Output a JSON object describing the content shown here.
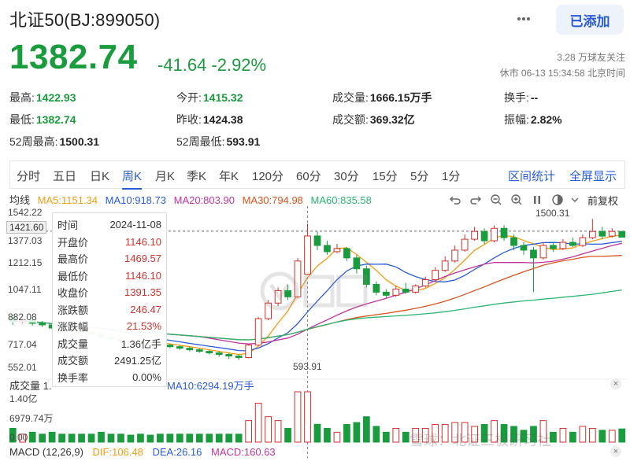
{
  "header": {
    "title": "北证50(BJ:899050)",
    "add_label": "已添加",
    "price": "1382.74",
    "change": "-41.64",
    "change_pct": "-2.92%",
    "followers": "3.28 万球友关注",
    "status": "休市 06-13 15:34:58 北京时间"
  },
  "stats": {
    "high_label": "最高:",
    "high": "1422.93",
    "open_label": "今开:",
    "open": "1415.32",
    "volume_label": "成交量:",
    "volume": "1666.15万手",
    "turnover_label": "换手:",
    "turnover": "--",
    "low_label": "最低:",
    "low": "1382.74",
    "prev_label": "昨收:",
    "prev": "1424.38",
    "amount_label": "成交额:",
    "amount": "369.32亿",
    "amplitude_label": "振幅:",
    "amplitude": "2.82%",
    "w52h_label": "52周最高:",
    "w52h": "1500.31",
    "w52l_label": "52周最低:",
    "w52l": "593.91"
  },
  "tabs": [
    "分时",
    "五日",
    "日K",
    "周K",
    "月K",
    "季K",
    "年K",
    "120分",
    "60分",
    "30分",
    "15分",
    "5分",
    "1分"
  ],
  "active_tab": "周K",
  "tabs_right": [
    "区间统计",
    "全屏显示"
  ],
  "ma": {
    "label": "均线",
    "ma5": "MA5:1151.34",
    "ma10": "MA10:918.73",
    "ma20": "MA20:803.90",
    "ma30": "MA30:794.98",
    "ma60": "MA60:835.58"
  },
  "fq_label": "前复权",
  "y_labels": [
    "1542.22",
    "1377.03",
    "1212.15",
    "1047.11",
    "882.08",
    "717.04",
    "552.01"
  ],
  "y_current": "1421.60",
  "high_marker": "1500.31",
  "low_marker": "593.91",
  "tooltip": {
    "rows": [
      {
        "k": "时间",
        "v": "2024-11-08"
      },
      {
        "k": "开盘价",
        "v": "1146.10"
      },
      {
        "k": "最高价",
        "v": "1469.57"
      },
      {
        "k": "最低价",
        "v": "1146.10"
      },
      {
        "k": "收盘价",
        "v": "1391.35"
      },
      {
        "k": "涨跌额",
        "v": "246.47"
      },
      {
        "k": "涨跌幅",
        "v": "21.53%"
      },
      {
        "k": "成交量",
        "v": "1.36亿手"
      },
      {
        "k": "成交额",
        "v": "2491.25亿"
      },
      {
        "k": "换手率",
        "v": "0.00%"
      }
    ]
  },
  "volume": {
    "label": "成交量 1.",
    "ma10": "MA10:6294.19万手",
    "y_labels": [
      "1.40亿",
      "6979.74万",
      "0.00"
    ]
  },
  "macd": {
    "label": "MACD (12,26,9)",
    "dif": "DIF:106.48",
    "dea": "DEA:26.16",
    "macd": "MACD:160.63"
  },
  "watermark": "雪球：北证三板研习社",
  "colors": {
    "up": "#d0312d",
    "down": "#1a9c3e",
    "accent": "#2a5bd7",
    "ma5": "#f39c12",
    "ma10": "#2a5bd7",
    "ma20": "#c0349b",
    "ma30": "#d9541e",
    "ma60": "#2bb673"
  },
  "chart_data": {
    "type": "candlestick",
    "y_range": [
      552.01,
      1542.22
    ],
    "weekly_candles": [
      {
        "o": 880,
        "c": 840,
        "h": 900,
        "l": 820
      },
      {
        "o": 840,
        "c": 850,
        "h": 870,
        "l": 830
      },
      {
        "o": 850,
        "c": 830,
        "h": 860,
        "l": 815
      },
      {
        "o": 830,
        "c": 820,
        "h": 845,
        "l": 805
      },
      {
        "o": 820,
        "c": 800,
        "h": 830,
        "l": 790
      },
      {
        "o": 800,
        "c": 790,
        "h": 815,
        "l": 780
      },
      {
        "o": 790,
        "c": 780,
        "h": 800,
        "l": 770
      },
      {
        "o": 780,
        "c": 770,
        "h": 790,
        "l": 760
      },
      {
        "o": 770,
        "c": 760,
        "h": 780,
        "l": 750
      },
      {
        "o": 760,
        "c": 740,
        "h": 770,
        "l": 730
      },
      {
        "o": 740,
        "c": 730,
        "h": 752,
        "l": 720
      },
      {
        "o": 730,
        "c": 720,
        "h": 740,
        "l": 710
      },
      {
        "o": 720,
        "c": 715,
        "h": 735,
        "l": 700
      },
      {
        "o": 715,
        "c": 705,
        "h": 725,
        "l": 695
      },
      {
        "o": 705,
        "c": 700,
        "h": 715,
        "l": 690
      },
      {
        "o": 700,
        "c": 690,
        "h": 710,
        "l": 680
      },
      {
        "o": 690,
        "c": 680,
        "h": 700,
        "l": 670
      },
      {
        "o": 680,
        "c": 670,
        "h": 690,
        "l": 660
      },
      {
        "o": 670,
        "c": 660,
        "h": 680,
        "l": 650
      },
      {
        "o": 660,
        "c": 650,
        "h": 670,
        "l": 640
      },
      {
        "o": 650,
        "c": 640,
        "h": 660,
        "l": 630
      },
      {
        "o": 640,
        "c": 630,
        "h": 650,
        "l": 615
      },
      {
        "o": 630,
        "c": 620,
        "h": 640,
        "l": 600
      },
      {
        "o": 620,
        "c": 610,
        "h": 630,
        "l": 594
      },
      {
        "o": 610,
        "c": 690,
        "h": 700,
        "l": 605
      },
      {
        "o": 690,
        "c": 860,
        "h": 870,
        "l": 685
      },
      {
        "o": 860,
        "c": 960,
        "h": 980,
        "l": 850
      },
      {
        "o": 960,
        "c": 1040,
        "h": 1060,
        "l": 940
      },
      {
        "o": 1040,
        "c": 1000,
        "h": 1080,
        "l": 980
      },
      {
        "o": 1000,
        "c": 1230,
        "h": 1250,
        "l": 990
      },
      {
        "o": 1146,
        "c": 1391,
        "h": 1470,
        "l": 1146
      },
      {
        "o": 1391,
        "c": 1330,
        "h": 1420,
        "l": 1300
      },
      {
        "o": 1330,
        "c": 1290,
        "h": 1360,
        "l": 1270
      },
      {
        "o": 1290,
        "c": 1310,
        "h": 1340,
        "l": 1280
      },
      {
        "o": 1310,
        "c": 1250,
        "h": 1320,
        "l": 1230
      },
      {
        "o": 1250,
        "c": 1180,
        "h": 1270,
        "l": 1150
      },
      {
        "o": 1180,
        "c": 1080,
        "h": 1200,
        "l": 1060
      },
      {
        "o": 1080,
        "c": 1030,
        "h": 1100,
        "l": 1010
      },
      {
        "o": 1030,
        "c": 1010,
        "h": 1050,
        "l": 990
      },
      {
        "o": 1010,
        "c": 1050,
        "h": 1070,
        "l": 1000
      },
      {
        "o": 1050,
        "c": 1030,
        "h": 1090,
        "l": 1020
      },
      {
        "o": 1030,
        "c": 1070,
        "h": 1080,
        "l": 1020
      },
      {
        "o": 1070,
        "c": 1110,
        "h": 1130,
        "l": 1060
      },
      {
        "o": 1110,
        "c": 1170,
        "h": 1190,
        "l": 1100
      },
      {
        "o": 1170,
        "c": 1230,
        "h": 1260,
        "l": 1160
      },
      {
        "o": 1230,
        "c": 1300,
        "h": 1330,
        "l": 1220
      },
      {
        "o": 1300,
        "c": 1370,
        "h": 1400,
        "l": 1290
      },
      {
        "o": 1370,
        "c": 1420,
        "h": 1450,
        "l": 1360
      },
      {
        "o": 1420,
        "c": 1360,
        "h": 1440,
        "l": 1340
      },
      {
        "o": 1360,
        "c": 1440,
        "h": 1460,
        "l": 1350
      },
      {
        "o": 1440,
        "c": 1380,
        "h": 1460,
        "l": 1360
      },
      {
        "o": 1380,
        "c": 1330,
        "h": 1400,
        "l": 1300
      },
      {
        "o": 1330,
        "c": 1300,
        "h": 1350,
        "l": 1270
      },
      {
        "o": 1300,
        "c": 1250,
        "h": 1320,
        "l": 1030
      },
      {
        "o": 1250,
        "c": 1330,
        "h": 1350,
        "l": 1240
      },
      {
        "o": 1330,
        "c": 1310,
        "h": 1350,
        "l": 1290
      },
      {
        "o": 1310,
        "c": 1350,
        "h": 1370,
        "l": 1300
      },
      {
        "o": 1350,
        "c": 1330,
        "h": 1380,
        "l": 1320
      },
      {
        "o": 1330,
        "c": 1380,
        "h": 1400,
        "l": 1320
      },
      {
        "o": 1380,
        "c": 1420,
        "h": 1500,
        "l": 1370
      },
      {
        "o": 1420,
        "c": 1390,
        "h": 1450,
        "l": 1370
      },
      {
        "o": 1390,
        "c": 1420,
        "h": 1440,
        "l": 1380
      },
      {
        "o": 1420,
        "c": 1383,
        "h": 1423,
        "l": 1383
      }
    ]
  }
}
